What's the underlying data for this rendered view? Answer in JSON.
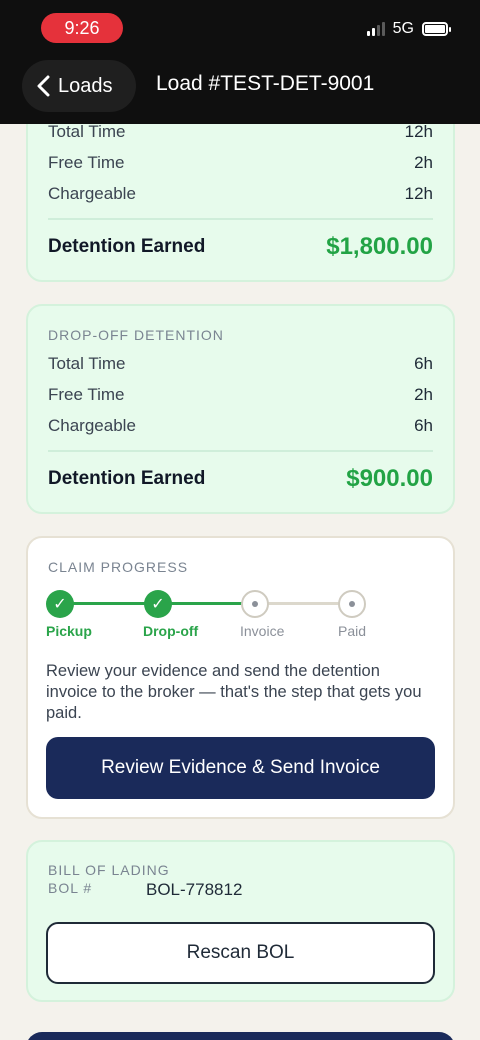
{
  "status_bar": {
    "time": "9:26",
    "network": "5G"
  },
  "nav": {
    "back_label": "Loads",
    "title": "Load #TEST-DET-9001"
  },
  "pickup_detention": {
    "rows": [
      {
        "label": "Total Time",
        "value": "12h"
      },
      {
        "label": "Free Time",
        "value": "2h"
      },
      {
        "label": "Chargeable",
        "value": "12h"
      }
    ],
    "earned_label": "Detention Earned",
    "earned_value": "$1,800.00"
  },
  "dropoff_detention": {
    "title": "DROP-OFF DETENTION",
    "rows": [
      {
        "label": "Total Time",
        "value": "6h"
      },
      {
        "label": "Free Time",
        "value": "2h"
      },
      {
        "label": "Chargeable",
        "value": "6h"
      }
    ],
    "earned_label": "Detention Earned",
    "earned_value": "$900.00"
  },
  "claim_progress": {
    "title": "CLAIM PROGRESS",
    "steps": [
      {
        "label": "Pickup",
        "status": "done"
      },
      {
        "label": "Drop-off",
        "status": "done"
      },
      {
        "label": "Invoice",
        "status": "pending"
      },
      {
        "label": "Paid",
        "status": "pending"
      }
    ],
    "message": "Review your evidence and send the detention invoice to the broker — that's the step that gets you paid.",
    "button_label": "Review Evidence & Send Invoice"
  },
  "bill_of_lading": {
    "title": "BILL OF LADING",
    "bol_label": "BOL #",
    "bol_value": "BOL-778812",
    "button_label": "Rescan BOL"
  },
  "colors": {
    "accent_green": "#22a345",
    "primary_navy": "#1a2a5a",
    "card_green_bg": "#e7fbec",
    "time_pill": "#e5323b"
  }
}
